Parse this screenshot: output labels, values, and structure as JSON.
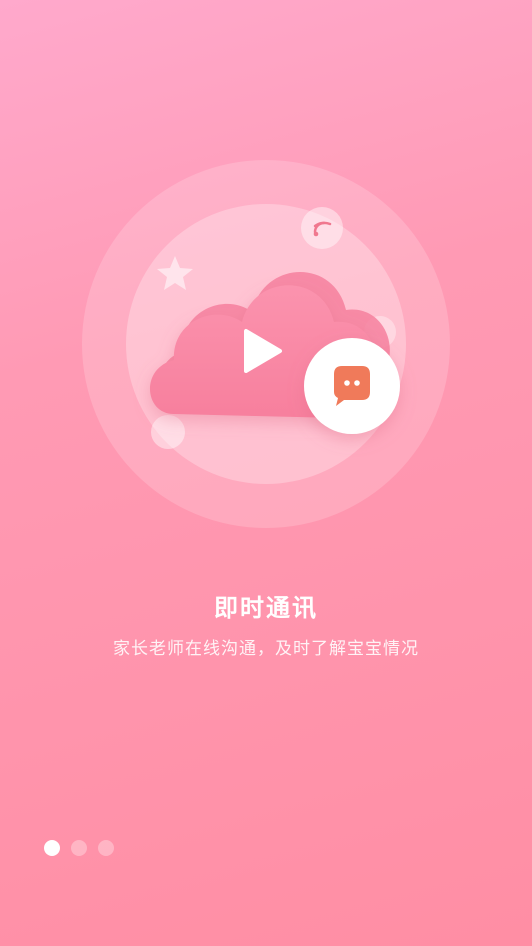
{
  "onboarding": {
    "title": "即时通讯",
    "subtitle": "家长老师在线沟通，及时了解宝宝情况",
    "illustration": {
      "icons": [
        "cloud-icon",
        "play-icon",
        "chat-bubble-icon",
        "wifi-icon",
        "star-icon"
      ]
    },
    "pagination": {
      "total": 3,
      "current": 1
    }
  },
  "colors": {
    "background_top": "#ffa9cc",
    "background_bottom": "#ff8ea4",
    "chat_bubble": "#f07a5a",
    "cloud": "#f78aa6"
  }
}
